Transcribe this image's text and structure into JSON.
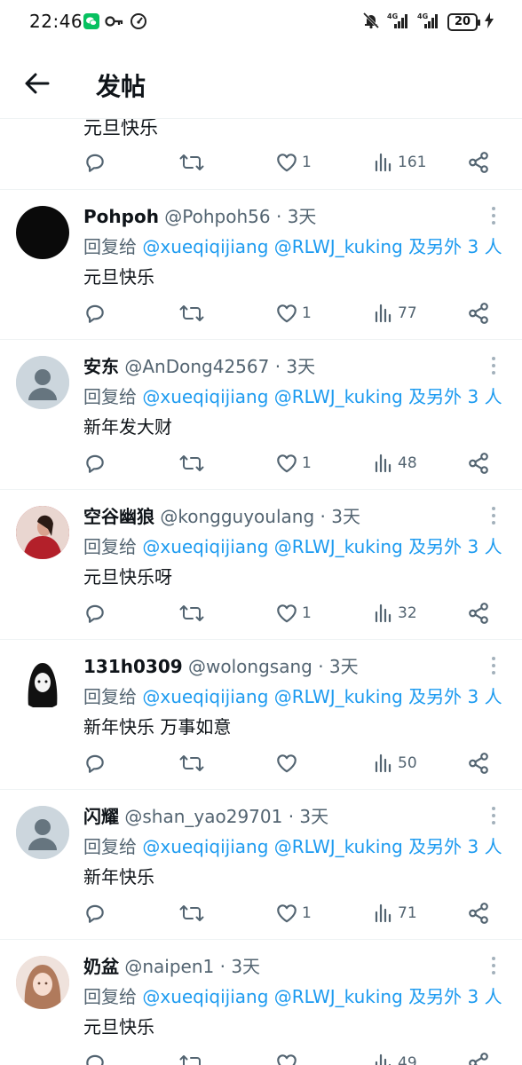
{
  "status_bar": {
    "time": "22:46",
    "network1": "4G",
    "network2": "4G",
    "battery": "20"
  },
  "header": {
    "title": "发帖"
  },
  "partial_post": {
    "content": "元旦快乐",
    "likes": "1",
    "views": "161"
  },
  "posts": [
    {
      "name": "Pohpoh",
      "handle": "@Pohpoh56",
      "time": "· 3天",
      "reply_prefix": "回复给 ",
      "reply_links": "@xueqiqijiang @RLWJ_kuking 及另外 3 人",
      "content": "元旦快乐",
      "likes": "1",
      "views": "77",
      "avatar_color": "#0a0a0a"
    },
    {
      "name": "安东",
      "handle": "@AnDong42567",
      "time": "· 3天",
      "reply_prefix": "回复给 ",
      "reply_links": "@xueqiqijiang @RLWJ_kuking 及另外 3 人",
      "content": "新年发大财",
      "likes": "1",
      "views": "48",
      "avatar_color": "#ccd6dd"
    },
    {
      "name": "空谷幽狼",
      "handle": "@kongguyoulang",
      "time": "· 3天",
      "reply_prefix": "回复给 ",
      "reply_links": "@xueqiqijiang @RLWJ_kuking 及另外 3 人",
      "content": "元旦快乐呀",
      "likes": "1",
      "views": "32",
      "avatar_color": "#b3202a"
    },
    {
      "name": "131h0309",
      "handle": "@wolongsang",
      "time": "· 3天",
      "reply_prefix": "回复给 ",
      "reply_links": "@xueqiqijiang @RLWJ_kuking 及另外 3 人",
      "content": "新年快乐 万事如意",
      "likes": "",
      "views": "50",
      "avatar_color": "#ffffff"
    },
    {
      "name": "闪耀",
      "handle": "@shan_yao29701",
      "time": "· 3天",
      "reply_prefix": "回复给 ",
      "reply_links": "@xueqiqijiang @RLWJ_kuking 及另外 3 人",
      "content": "新年快乐",
      "likes": "1",
      "views": "71",
      "avatar_color": "#ccd6dd"
    },
    {
      "name": "奶盆",
      "handle": "@naipen1",
      "time": "· 3天",
      "reply_prefix": "回复给 ",
      "reply_links": "@xueqiqijiang @RLWJ_kuking 及另外 3 人",
      "content": "元旦快乐",
      "likes": "",
      "views": "49",
      "avatar_color": "#e8c9c0"
    }
  ],
  "icons": [
    "back-arrow-icon",
    "reply-icon",
    "retweet-icon",
    "like-icon",
    "views-icon",
    "share-icon",
    "more-icon",
    "wechat-icon",
    "key-icon",
    "speed-icon",
    "mute-icon",
    "signal-icon",
    "battery-icon"
  ],
  "colors": {
    "link": "#1d9bf0",
    "secondary_text": "#536471",
    "text": "#0f1419"
  }
}
